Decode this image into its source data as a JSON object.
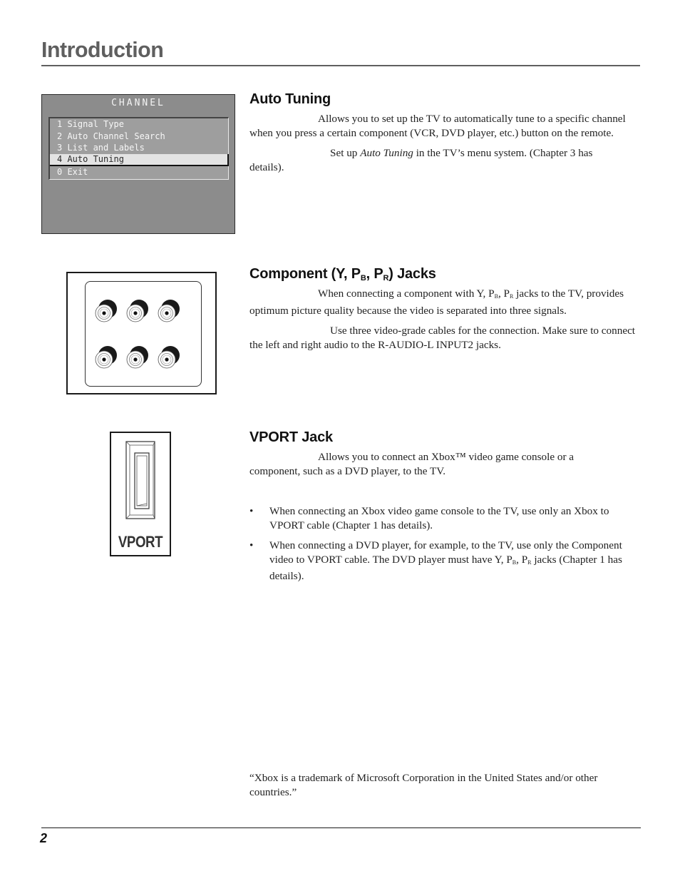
{
  "page": {
    "title": "Introduction",
    "page_number": "2"
  },
  "osd_menu": {
    "title": "CHANNEL",
    "items": [
      {
        "label": "1 Signal Type",
        "selected": false
      },
      {
        "label": "2 Auto Channel Search",
        "selected": false
      },
      {
        "label": "3 List and Labels",
        "selected": false
      },
      {
        "label": "4 Auto Tuning",
        "selected": true
      },
      {
        "label": "0 Exit",
        "selected": false
      }
    ]
  },
  "sections": {
    "auto_tuning": {
      "heading": "Auto Tuning",
      "para1": "Allows you to set up the TV to automatically tune to a specific channel when you press a certain component (VCR, DVD player, etc.) button on the remote.",
      "para2_pre": "Set up ",
      "para2_em": "Auto Tuning",
      "para2_post": " in the TV’s menu system. (Chapter 3 has details)."
    },
    "component": {
      "heading_pre": "Component  (Y, P",
      "heading_sub1": "B",
      "heading_mid": ", P",
      "heading_sub2": "R",
      "heading_post": ") Jacks",
      "para1_a": "When connecting a component with Y, P",
      "para1_sub1": "B",
      "para1_b": ", P",
      "para1_sub2": "R",
      "para1_c": " jacks to the TV, provides optimum picture quality because the video is separated into three signals.",
      "para2": "Use three video-grade cables for the connection. Make sure to connect the left and right audio to the R-AUDIO-L INPUT2 jacks."
    },
    "vport": {
      "heading": "VPORT Jack",
      "para1": "Allows you to connect an Xbox™ video game console or a component, such as a DVD player, to the TV.",
      "bullet_char": "•",
      "bullet1": "When connecting an Xbox video game console to the TV, use only an Xbox to VPORT cable (Chapter 1 has details).",
      "bullet2_a": "When connecting a DVD player, for example, to the TV, use only the Component video to VPORT cable. The DVD player must have Y, P",
      "bullet2_sub1": "B",
      "bullet2_b": ", P",
      "bullet2_sub2": "R",
      "bullet2_c": " jacks (Chapter 1 has details).",
      "image_label": "VPORT"
    }
  },
  "trademark_note": "“Xbox is a trademark of Microsoft Corporation in the United States and/or other countries.”",
  "illustrations": {
    "jacks": {
      "rows": 2,
      "cols": 3
    }
  }
}
